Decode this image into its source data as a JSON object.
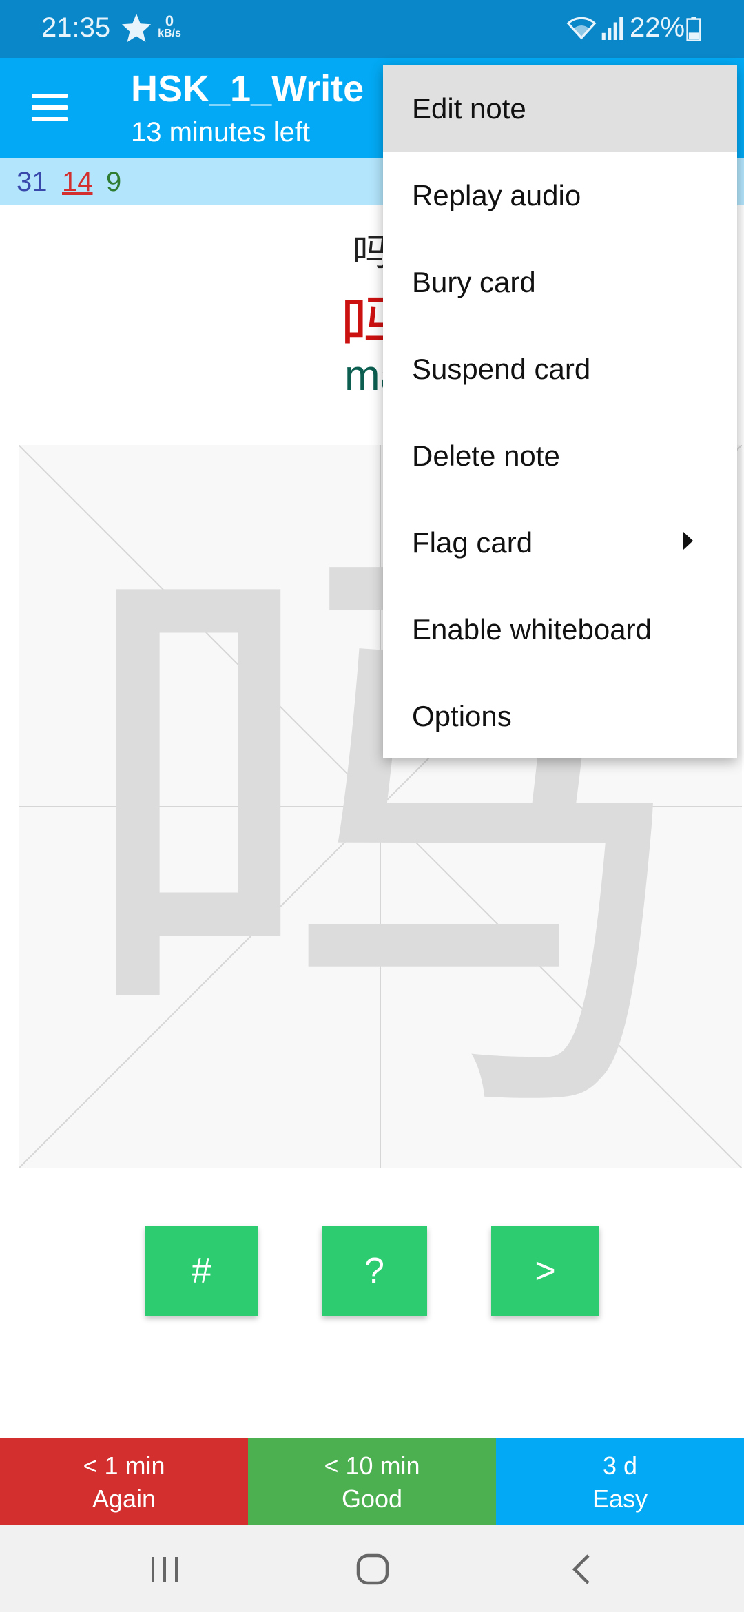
{
  "status_bar": {
    "time": "21:35",
    "net_speed_value": "0",
    "net_speed_unit": "kB/s",
    "battery": "22%",
    "icons": [
      "star-icon",
      "wifi-icon",
      "signal-icon",
      "battery-icon"
    ]
  },
  "toolbar": {
    "title": "HSK_1_Write",
    "subtitle": "13 minutes left",
    "icon": "menu-icon"
  },
  "counts": {
    "new": "31",
    "learning": "14",
    "review": "9"
  },
  "card": {
    "small_hanzi": "吗",
    "big_hanzi": "吗",
    "pinyin": "ma",
    "whiteboard_character": "吗"
  },
  "tool_buttons": {
    "hash": "#",
    "help": "?",
    "next": ">"
  },
  "answers": [
    {
      "interval": "< 1 min",
      "label": "Again"
    },
    {
      "interval": "< 10 min",
      "label": "Good"
    },
    {
      "interval": "3 d",
      "label": "Easy"
    }
  ],
  "overflow_menu": {
    "items": [
      {
        "label": "Edit note"
      },
      {
        "label": "Replay audio"
      },
      {
        "label": "Bury card"
      },
      {
        "label": "Suspend card"
      },
      {
        "label": "Delete note"
      },
      {
        "label": "Flag card"
      },
      {
        "label": "Enable whiteboard"
      },
      {
        "label": "Options"
      }
    ],
    "highlighted_index": 0,
    "submenu_item_index": 5
  },
  "colors": {
    "status_bar": "#0a87c8",
    "toolbar": "#03a9f4",
    "counts_bar": "#b3e5fc",
    "again": "#d32f2f",
    "good": "#4caf50",
    "easy": "#03a9f4",
    "tool_button": "#2ecc71",
    "hanzi_red": "#cc1111",
    "pinyin_green": "#0b5e50"
  }
}
